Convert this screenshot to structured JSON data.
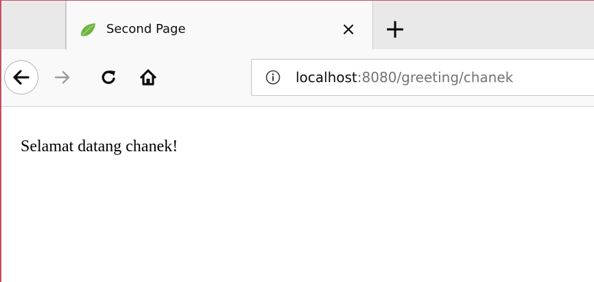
{
  "tab": {
    "title": "Second Page",
    "close_glyph": "×",
    "favicon": "spring-leaf-icon"
  },
  "newtab": {
    "glyph": "+"
  },
  "nav": {
    "back_icon": "back-arrow-icon",
    "forward_icon": "forward-arrow-icon",
    "reload_icon": "reload-icon",
    "home_icon": "home-icon"
  },
  "urlbar": {
    "info_icon": "info-icon",
    "host": "localhost",
    "rest": ":8080/greeting/chanek"
  },
  "page": {
    "greeting": "Selamat datang chanek!"
  },
  "colors": {
    "window_border": "#c94a5b",
    "favicon_green": "#6db33f",
    "url_muted": "#737373"
  }
}
